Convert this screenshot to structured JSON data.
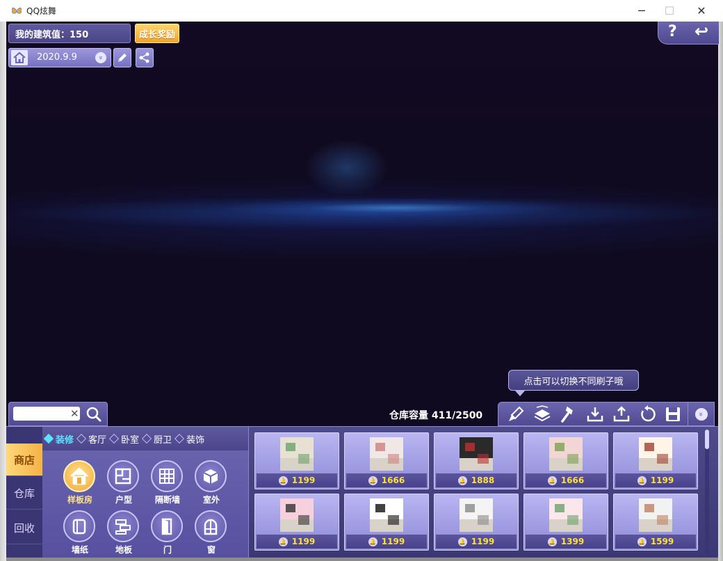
{
  "window": {
    "title": "QQ炫舞",
    "minimize": "─",
    "maximize": "☐",
    "close": "✕"
  },
  "hud": {
    "build_value": "我的建筑值：150",
    "reward_label": "成长奖励",
    "date": "2020.9.9",
    "date_chevron": "»"
  },
  "top_right": {
    "help": "?",
    "back": "↩"
  },
  "search": {
    "value": "",
    "placeholder": "",
    "clear": "✕"
  },
  "storage": {
    "label": "仓库容量 411/2500"
  },
  "tooltip": "点击可以切换不同刷子哦",
  "left_tabs": [
    "商店",
    "仓库",
    "回收"
  ],
  "subtabs": [
    {
      "label": "装修",
      "active": true
    },
    {
      "label": "客厅",
      "active": false
    },
    {
      "label": "卧室",
      "active": false
    },
    {
      "label": "厨卫",
      "active": false
    },
    {
      "label": "装饰",
      "active": false
    }
  ],
  "categories": [
    {
      "label": "样板房",
      "icon": "house-icon",
      "active": true
    },
    {
      "label": "户型",
      "icon": "floorplan-icon",
      "active": false
    },
    {
      "label": "隔断墙",
      "icon": "wall-grid-icon",
      "active": false
    },
    {
      "label": "室外",
      "icon": "outdoor-cube-icon",
      "active": false
    },
    {
      "label": "墙纸",
      "icon": "wallpaper-icon",
      "active": false
    },
    {
      "label": "地板",
      "icon": "floor-icon",
      "active": false
    },
    {
      "label": "门",
      "icon": "door-icon",
      "active": false
    },
    {
      "label": "窗",
      "icon": "window-icon",
      "active": false
    }
  ],
  "items": [
    {
      "price": "1199",
      "thumb": "#e8e0d0",
      "accent": "#6aa36a"
    },
    {
      "price": "1666",
      "thumb": "#f0e8e6",
      "accent": "#d08080"
    },
    {
      "price": "1888",
      "thumb": "#2a2a2a",
      "accent": "#c03030"
    },
    {
      "price": "1666",
      "thumb": "#f2d6d6",
      "accent": "#7aa050"
    },
    {
      "price": "1199",
      "thumb": "#fff4e8",
      "accent": "#a04030"
    },
    {
      "price": "1199",
      "thumb": "#f6d0dc",
      "accent": "#333333"
    },
    {
      "price": "1199",
      "thumb": "#ffffff",
      "accent": "#111111"
    },
    {
      "price": "1199",
      "thumb": "#f4f4f4",
      "accent": "#8a8a8a"
    },
    {
      "price": "1399",
      "thumb": "#fbe6ec",
      "accent": "#6aa36a"
    },
    {
      "price": "1599",
      "thumb": "#f2f2f2",
      "accent": "#c08060"
    }
  ],
  "colors": {
    "accent_gold": "#f2a93a",
    "panel": "#4e4a8c",
    "price": "#ffe03a",
    "active_tab_text": "#5ce1ff"
  }
}
